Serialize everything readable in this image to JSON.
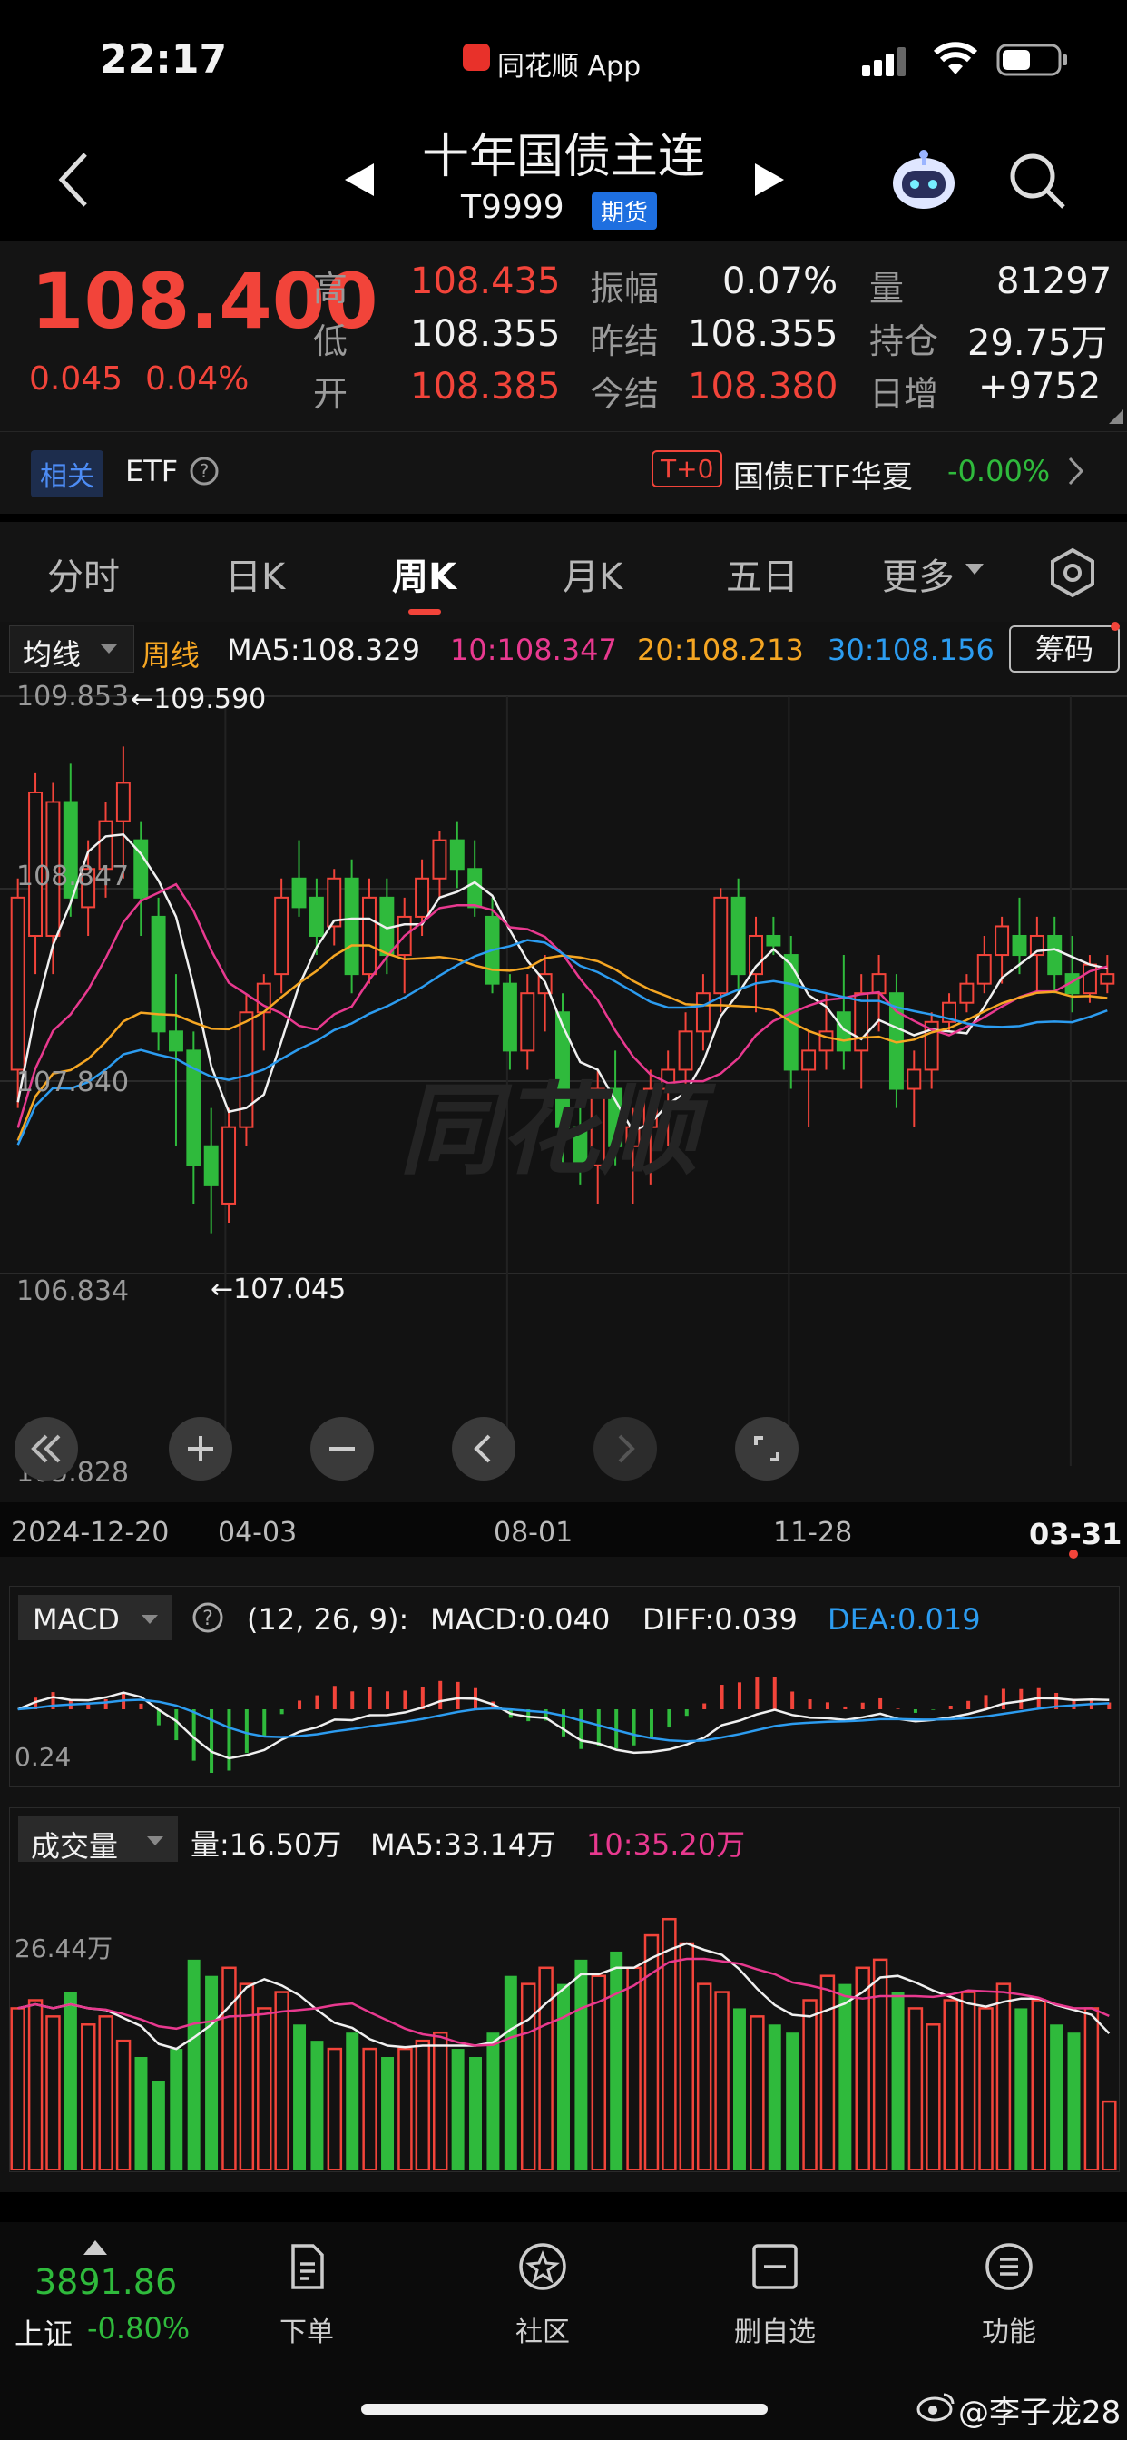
{
  "status_bar": {
    "time": "22:17",
    "app": "同花顺 App"
  },
  "header": {
    "title": "十年国债主连",
    "code": "T9999",
    "badge": "期货"
  },
  "quote": {
    "price": "108.400",
    "change": "0.045",
    "change_pct": "0.04%",
    "high_label": "高",
    "high": "108.435",
    "low_label": "低",
    "low": "108.355",
    "open_label": "开",
    "open": "108.385",
    "amp_label": "振幅",
    "amp": "0.07%",
    "prev_label": "昨结",
    "prev": "108.355",
    "settle_label": "今结",
    "settle": "108.380",
    "vol_label": "量",
    "vol": "81297",
    "oi_label": "持仓",
    "oi": "29.75万",
    "oi_chg_label": "日增",
    "oi_chg": "+9752"
  },
  "etf": {
    "related": "相关",
    "etf": "ETF",
    "t0": "T+0",
    "name": "国债ETF华夏",
    "pct": "-0.00%"
  },
  "tabs": [
    "分时",
    "日K",
    "周K",
    "月K",
    "五日",
    "更多"
  ],
  "active_tab": "周K",
  "ma_bar": {
    "selector": "均线",
    "period": "周线",
    "ma5": "MA5:108.329",
    "ma10": "10:108.347",
    "ma20": "20:108.213",
    "ma30": "30:108.156",
    "chip": "筹码"
  },
  "price_axis": [
    "109.853",
    "108.847",
    "107.840",
    "106.834",
    "105.828"
  ],
  "annotations": {
    "high": "←109.590",
    "low": "←107.045"
  },
  "date_axis": [
    "2024-12-20",
    "04-03",
    "08-01",
    "11-28",
    "03-31"
  ],
  "watermark": "同花顺",
  "macd_bar": {
    "selector": "MACD",
    "params": "(12, 26, 9):",
    "macd": "MACD:0.040",
    "diff": "DIFF:0.039",
    "dea": "DEA:0.019",
    "axis": "0.24"
  },
  "vol_bar": {
    "selector": "成交量",
    "vol": "量:16.50万",
    "ma5": "MA5:33.14万",
    "ma10": "10:35.20万",
    "axis": "26.44万"
  },
  "bottom": {
    "index_value": "3891.86",
    "index_name": "上证",
    "index_pct": "-0.80%",
    "nav": [
      "下单",
      "社区",
      "删自选",
      "功能"
    ]
  },
  "footer": {
    "weibo": "@李子龙28"
  },
  "colors": {
    "up": "#f2443a",
    "down": "#2fba3c",
    "ma5": "#f0f0f0",
    "ma10": "#e8398f",
    "ma20": "#f5a623",
    "ma30": "#2c9cf0",
    "accent": "#f2443a"
  },
  "chart_data": {
    "type": "candlestick",
    "title": "十年国债主连 周K",
    "ylim": [
      105.828,
      109.853
    ],
    "candles": [
      {
        "o": 107.9,
        "h": 108.9,
        "l": 107.7,
        "c": 108.8
      },
      {
        "o": 108.6,
        "h": 109.45,
        "l": 108.4,
        "c": 109.35
      },
      {
        "o": 108.6,
        "h": 109.4,
        "l": 108.4,
        "c": 109.3
      },
      {
        "o": 109.3,
        "h": 109.5,
        "l": 108.7,
        "c": 108.8
      },
      {
        "o": 108.75,
        "h": 109.1,
        "l": 108.6,
        "c": 108.95
      },
      {
        "o": 108.95,
        "h": 109.3,
        "l": 108.8,
        "c": 109.2
      },
      {
        "o": 109.2,
        "h": 109.59,
        "l": 108.9,
        "c": 109.4
      },
      {
        "o": 109.1,
        "h": 109.2,
        "l": 108.6,
        "c": 108.8
      },
      {
        "o": 108.7,
        "h": 108.8,
        "l": 108.0,
        "c": 108.1
      },
      {
        "o": 108.1,
        "h": 108.4,
        "l": 107.5,
        "c": 108.0
      },
      {
        "o": 108.0,
        "h": 108.1,
        "l": 107.2,
        "c": 107.4
      },
      {
        "o": 107.5,
        "h": 107.7,
        "l": 107.045,
        "c": 107.3
      },
      {
        "o": 107.2,
        "h": 107.7,
        "l": 107.1,
        "c": 107.6
      },
      {
        "o": 107.6,
        "h": 108.3,
        "l": 107.5,
        "c": 108.2
      },
      {
        "o": 108.2,
        "h": 108.4,
        "l": 108.0,
        "c": 108.35
      },
      {
        "o": 108.4,
        "h": 108.9,
        "l": 108.3,
        "c": 108.8
      },
      {
        "o": 108.9,
        "h": 109.1,
        "l": 108.7,
        "c": 108.75
      },
      {
        "o": 108.8,
        "h": 108.9,
        "l": 108.5,
        "c": 108.6
      },
      {
        "o": 108.65,
        "h": 108.95,
        "l": 108.55,
        "c": 108.9
      },
      {
        "o": 108.9,
        "h": 109.0,
        "l": 108.3,
        "c": 108.4
      },
      {
        "o": 108.4,
        "h": 108.9,
        "l": 108.35,
        "c": 108.8
      },
      {
        "o": 108.8,
        "h": 108.9,
        "l": 108.4,
        "c": 108.5
      },
      {
        "o": 108.5,
        "h": 108.8,
        "l": 108.3,
        "c": 108.7
      },
      {
        "o": 108.7,
        "h": 109.0,
        "l": 108.6,
        "c": 108.9
      },
      {
        "o": 108.9,
        "h": 109.15,
        "l": 108.8,
        "c": 109.1
      },
      {
        "o": 109.1,
        "h": 109.2,
        "l": 108.85,
        "c": 108.95
      },
      {
        "o": 108.95,
        "h": 109.1,
        "l": 108.7,
        "c": 108.75
      },
      {
        "o": 108.7,
        "h": 108.8,
        "l": 108.3,
        "c": 108.35
      },
      {
        "o": 108.35,
        "h": 108.4,
        "l": 107.9,
        "c": 108.0
      },
      {
        "o": 108.0,
        "h": 108.4,
        "l": 107.9,
        "c": 108.3
      },
      {
        "o": 108.3,
        "h": 108.5,
        "l": 108.1,
        "c": 108.4
      },
      {
        "o": 108.2,
        "h": 108.3,
        "l": 107.4,
        "c": 107.6
      },
      {
        "o": 107.6,
        "h": 107.7,
        "l": 107.3,
        "c": 107.4
      },
      {
        "o": 107.4,
        "h": 107.9,
        "l": 107.2,
        "c": 107.8
      },
      {
        "o": 107.8,
        "h": 108.0,
        "l": 107.4,
        "c": 107.5
      },
      {
        "o": 107.5,
        "h": 107.7,
        "l": 107.2,
        "c": 107.6
      },
      {
        "o": 107.6,
        "h": 107.9,
        "l": 107.3,
        "c": 107.8
      },
      {
        "o": 107.8,
        "h": 108.0,
        "l": 107.5,
        "c": 107.9
      },
      {
        "o": 107.9,
        "h": 108.2,
        "l": 107.8,
        "c": 108.1
      },
      {
        "o": 108.1,
        "h": 108.4,
        "l": 108.0,
        "c": 108.3
      },
      {
        "o": 108.3,
        "h": 108.85,
        "l": 108.2,
        "c": 108.8
      },
      {
        "o": 108.8,
        "h": 108.9,
        "l": 108.3,
        "c": 108.4
      },
      {
        "o": 108.4,
        "h": 108.7,
        "l": 108.2,
        "c": 108.6
      },
      {
        "o": 108.6,
        "h": 108.7,
        "l": 108.5,
        "c": 108.55
      },
      {
        "o": 108.5,
        "h": 108.6,
        "l": 107.8,
        "c": 107.9
      },
      {
        "o": 107.9,
        "h": 108.1,
        "l": 107.6,
        "c": 108.0
      },
      {
        "o": 108.0,
        "h": 108.3,
        "l": 107.9,
        "c": 108.1
      },
      {
        "o": 108.2,
        "h": 108.5,
        "l": 107.9,
        "c": 108.0
      },
      {
        "o": 108.0,
        "h": 108.4,
        "l": 107.8,
        "c": 108.3
      },
      {
        "o": 108.3,
        "h": 108.5,
        "l": 108.1,
        "c": 108.4
      },
      {
        "o": 108.3,
        "h": 108.4,
        "l": 107.7,
        "c": 107.8
      },
      {
        "o": 107.8,
        "h": 108.0,
        "l": 107.6,
        "c": 107.9
      },
      {
        "o": 107.9,
        "h": 108.2,
        "l": 107.8,
        "c": 108.15
      },
      {
        "o": 108.15,
        "h": 108.3,
        "l": 108.1,
        "c": 108.25
      },
      {
        "o": 108.25,
        "h": 108.4,
        "l": 108.2,
        "c": 108.35
      },
      {
        "o": 108.35,
        "h": 108.6,
        "l": 108.3,
        "c": 108.5
      },
      {
        "o": 108.5,
        "h": 108.7,
        "l": 108.35,
        "c": 108.65
      },
      {
        "o": 108.6,
        "h": 108.8,
        "l": 108.4,
        "c": 108.5
      },
      {
        "o": 108.5,
        "h": 108.7,
        "l": 108.3,
        "c": 108.6
      },
      {
        "o": 108.6,
        "h": 108.7,
        "l": 108.3,
        "c": 108.4
      },
      {
        "o": 108.4,
        "h": 108.6,
        "l": 108.2,
        "c": 108.3
      },
      {
        "o": 108.3,
        "h": 108.5,
        "l": 108.25,
        "c": 108.45
      },
      {
        "o": 108.35,
        "h": 108.5,
        "l": 108.3,
        "c": 108.4
      }
    ],
    "volumes": [
      40,
      42,
      38,
      44,
      36,
      38,
      32,
      28,
      22,
      30,
      52,
      48,
      50,
      46,
      40,
      44,
      36,
      32,
      30,
      34,
      30,
      28,
      30,
      32,
      34,
      30,
      28,
      34,
      48,
      46,
      50,
      46,
      52,
      48,
      54,
      50,
      58,
      62,
      56,
      46,
      44,
      40,
      38,
      36,
      34,
      42,
      48,
      46,
      50,
      52,
      44,
      40,
      36,
      42,
      44,
      40,
      46,
      40,
      42,
      36,
      34,
      40,
      17
    ]
  }
}
